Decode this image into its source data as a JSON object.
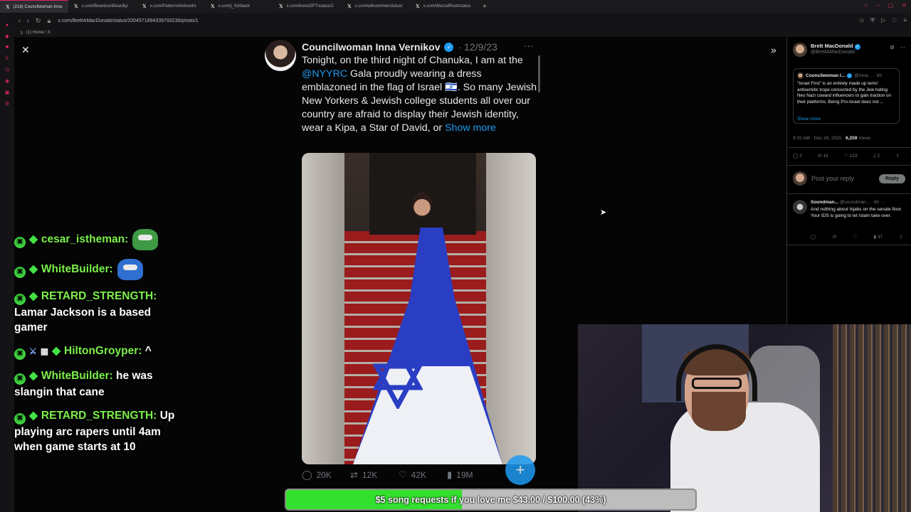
{
  "browser": {
    "tabs": [
      {
        "label": "(216) Councilwoman Inna",
        "active": true
      },
      {
        "label": "x.com/BeardsonBeardly/",
        "active": false
      },
      {
        "label": "x.com/PatternsNoticed/s",
        "active": false
      },
      {
        "label": "x.com/j_fishback",
        "active": false
      },
      {
        "label": "x.com/boneOPT/status/2",
        "active": false
      },
      {
        "label": "x.com/willsommer/status/",
        "active": false
      },
      {
        "label": "x.com/WurzelRoot/status",
        "active": false
      }
    ],
    "url": "x.com/BrettAMacDonald/status/2004571894339793236/photo/1",
    "bookmark": "(1) Home / X"
  },
  "tweet": {
    "name": "Councilwoman Inna Vernikov",
    "date": "12/9/23",
    "text_1": "Tonight, on the third night of Chanuka, I am at the ",
    "mention": "@NYYRC",
    "text_2": " Gala proudly wearing a dress emblazoned in the flag of Israel 🇮🇱. So many Jewish New Yorkers & Jewish college students all over our country are afraid to display their Jewish identity, wear a Kipa, a Star of David, or ",
    "show_more": "Show more",
    "replies": "20K",
    "reposts": "12K",
    "likes": "42K",
    "views": "19M"
  },
  "sidebar": {
    "author_name": "Brett MacDonald",
    "author_handle": "@BrettAMacDonald",
    "quote_name": "Councilwoman I...",
    "quote_handle": "@Inna...",
    "quote_time": "· 8h",
    "quote_text": "\"Israel First\" is an entirely made up term/ antisemitic trope concocted by the Jew hating Neo Nazi coward influencers to gain traction on their platforms. Being Pro-Israel does not ...",
    "quote_show_more": "Show more",
    "meta_time": "9:15 AM · Dec 26, 2025 · ",
    "meta_views": "6,259",
    "meta_views_label": " Views",
    "replies": "2",
    "reposts": "19",
    "likes": "123",
    "bookmarks": "2",
    "reply_placeholder": "Post your reply",
    "reply_button": "Reply",
    "reply_name": "Soundman...",
    "reply_handle": "@soundman...",
    "reply_time": "· 6h",
    "reply_text": "And nothing about hijabs on the senate floor. Your IDS is going to let Islam take over.",
    "reply_views": "47"
  },
  "chat": {
    "messages": [
      {
        "user": "cesar_istheman:",
        "text": ""
      },
      {
        "user": "WhiteBuilder:",
        "text": ""
      },
      {
        "user": "RETARD_STRENGTH:",
        "text": "Lamar Jackson is a based gamer"
      },
      {
        "user": "HiltonGroyper:",
        "text": "^"
      },
      {
        "user": "WhiteBuilder:",
        "text": "he was slangin that cane"
      },
      {
        "user": "RETARD_STRENGTH:",
        "text": "Up playing arc rapers until 4am when game starts at 10"
      }
    ]
  },
  "donation": {
    "label": "$5 song requests if you love me $43.00 / $100.00 (43%)",
    "progress": 0.43,
    "color": "#33e02e"
  }
}
